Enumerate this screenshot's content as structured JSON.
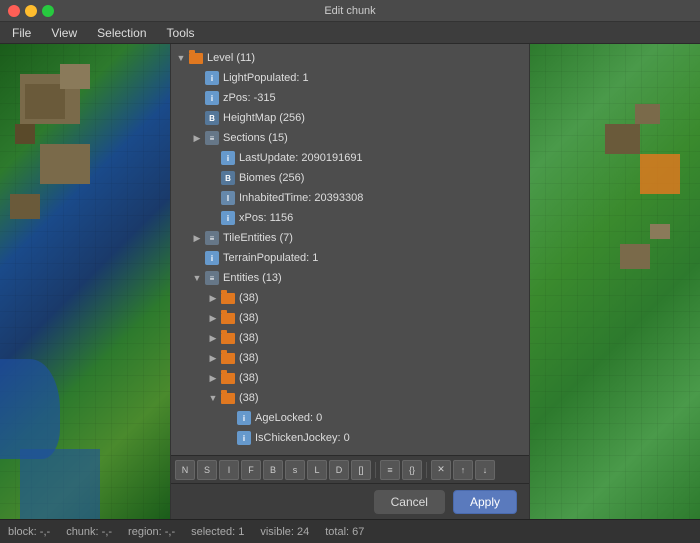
{
  "titleBar": {
    "title": "Edit chunk"
  },
  "menuBar": {
    "items": [
      "File",
      "View",
      "Selection",
      "Tools"
    ]
  },
  "treeData": {
    "items": [
      {
        "id": 1,
        "indent": 0,
        "type": "folder",
        "expanded": true,
        "label": "Level (11)"
      },
      {
        "id": 2,
        "indent": 1,
        "type": "int",
        "expanded": false,
        "label": "LightPopulated: 1"
      },
      {
        "id": 3,
        "indent": 1,
        "type": "int",
        "expanded": false,
        "label": "zPos: -315"
      },
      {
        "id": 4,
        "indent": 1,
        "type": "byteArr",
        "expanded": false,
        "label": "HeightMap (256)"
      },
      {
        "id": 5,
        "indent": 1,
        "type": "list",
        "expanded": false,
        "label": "Sections (15)"
      },
      {
        "id": 6,
        "indent": 2,
        "type": "int",
        "expanded": false,
        "label": "LastUpdate: 2090191691"
      },
      {
        "id": 7,
        "indent": 2,
        "type": "byteArr",
        "expanded": false,
        "label": "Biomes (256)"
      },
      {
        "id": 8,
        "indent": 2,
        "type": "long",
        "expanded": false,
        "label": "InhabitedTime: 20393308"
      },
      {
        "id": 9,
        "indent": 2,
        "type": "int",
        "expanded": false,
        "label": "xPos: 1156"
      },
      {
        "id": 10,
        "indent": 1,
        "type": "list",
        "expanded": false,
        "label": "TileEntities (7)"
      },
      {
        "id": 11,
        "indent": 1,
        "type": "int",
        "expanded": false,
        "label": "TerrainPopulated: 1"
      },
      {
        "id": 12,
        "indent": 1,
        "type": "list",
        "expanded": true,
        "label": "Entities (13)"
      },
      {
        "id": 13,
        "indent": 2,
        "type": "folder",
        "expanded": false,
        "label": "(38)"
      },
      {
        "id": 14,
        "indent": 2,
        "type": "folder",
        "expanded": false,
        "label": "(38)"
      },
      {
        "id": 15,
        "indent": 2,
        "type": "folder",
        "expanded": false,
        "label": "(38)"
      },
      {
        "id": 16,
        "indent": 2,
        "type": "folder",
        "expanded": false,
        "label": "(38)"
      },
      {
        "id": 17,
        "indent": 2,
        "type": "folder",
        "expanded": false,
        "label": "(38)"
      },
      {
        "id": 18,
        "indent": 2,
        "type": "folder",
        "expanded": true,
        "label": "(38)"
      },
      {
        "id": 19,
        "indent": 3,
        "type": "int",
        "expanded": false,
        "label": "AgeLocked: 0"
      },
      {
        "id": 20,
        "indent": 3,
        "type": "int",
        "expanded": false,
        "label": "IsChickenJockey: 0"
      }
    ]
  },
  "toolbar": {
    "buttons": [
      "nbt",
      "str",
      "int",
      "float",
      "byte",
      "short",
      "long",
      "double",
      "arr",
      "list",
      "compound",
      "del",
      "up",
      "dn"
    ]
  },
  "buttons": {
    "cancel": "Cancel",
    "apply": "Apply"
  },
  "statusBar": {
    "block": "block: -,-",
    "chunk": "chunk: -,-",
    "region": "region: -,-",
    "selected": "selected: 1",
    "visible": "visible: 24",
    "total": "total: 67"
  }
}
